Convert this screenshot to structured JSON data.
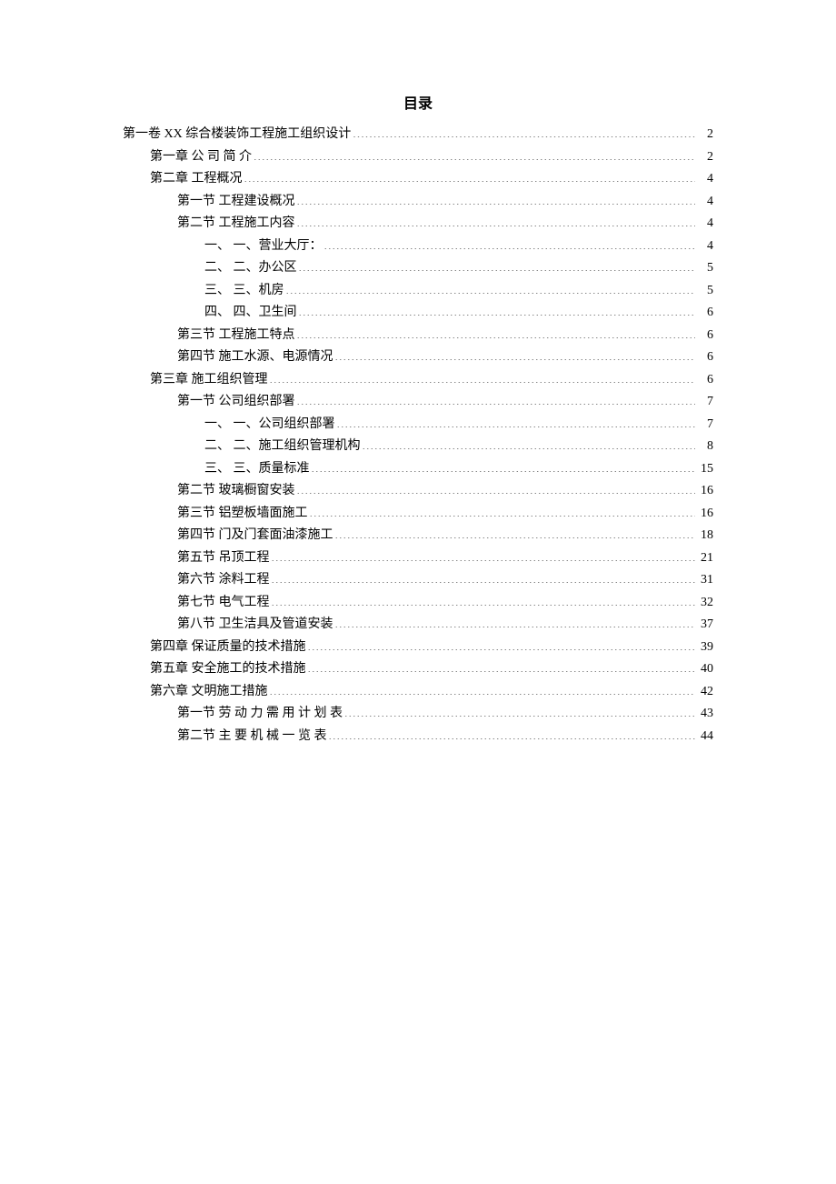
{
  "title": "目录",
  "entries": [
    {
      "label": "第一卷 XX 综合楼装饰工程施工组织设计",
      "page": "2",
      "indent": 0
    },
    {
      "label": "第一章 公 司 简 介",
      "page": "2",
      "indent": 1
    },
    {
      "label": "第二章 工程概况",
      "page": "4",
      "indent": 1
    },
    {
      "label": "第一节 工程建设概况",
      "page": "4",
      "indent": 2
    },
    {
      "label": "第二节 工程施工内容",
      "page": "4",
      "indent": 2
    },
    {
      "label": "一、 一、营业大厅：",
      "page": "4",
      "indent": 3
    },
    {
      "label": "二、 二、办公区",
      "page": "5",
      "indent": 3
    },
    {
      "label": "三、 三、机房",
      "page": "5",
      "indent": 3
    },
    {
      "label": "四、 四、卫生间",
      "page": "6",
      "indent": 3
    },
    {
      "label": "第三节 工程施工特点",
      "page": "6",
      "indent": 2
    },
    {
      "label": "第四节 施工水源、电源情况",
      "page": "6",
      "indent": 2
    },
    {
      "label": "第三章 施工组织管理",
      "page": "6",
      "indent": 1
    },
    {
      "label": "第一节 公司组织部署",
      "page": "7",
      "indent": 2
    },
    {
      "label": "一、 一、公司组织部署",
      "page": "7",
      "indent": 3
    },
    {
      "label": "二、 二、施工组织管理机构",
      "page": "8",
      "indent": 3
    },
    {
      "label": "三、 三、质量标准",
      "page": "15",
      "indent": 3
    },
    {
      "label": "第二节 玻璃橱窗安装",
      "page": "16",
      "indent": 2
    },
    {
      "label": "第三节 铝塑板墙面施工",
      "page": "16",
      "indent": 2
    },
    {
      "label": "第四节 门及门套面油漆施工",
      "page": "18",
      "indent": 2
    },
    {
      "label": "第五节 吊顶工程",
      "page": "21",
      "indent": 2
    },
    {
      "label": "第六节 涂料工程",
      "page": "31",
      "indent": 2
    },
    {
      "label": "第七节 电气工程",
      "page": "32",
      "indent": 2
    },
    {
      "label": "第八节 卫生洁具及管道安装",
      "page": "37",
      "indent": 2
    },
    {
      "label": "第四章 保证质量的技术措施",
      "page": "39",
      "indent": 1
    },
    {
      "label": "第五章 安全施工的技术措施",
      "page": "40",
      "indent": 1
    },
    {
      "label": "第六章 文明施工措施",
      "page": "42",
      "indent": 1
    },
    {
      "label": "第一节 劳 动 力 需 用 计 划 表",
      "page": "43",
      "indent": 2
    },
    {
      "label": "第二节 主 要 机 械 一 览 表",
      "page": "44",
      "indent": 2
    }
  ]
}
